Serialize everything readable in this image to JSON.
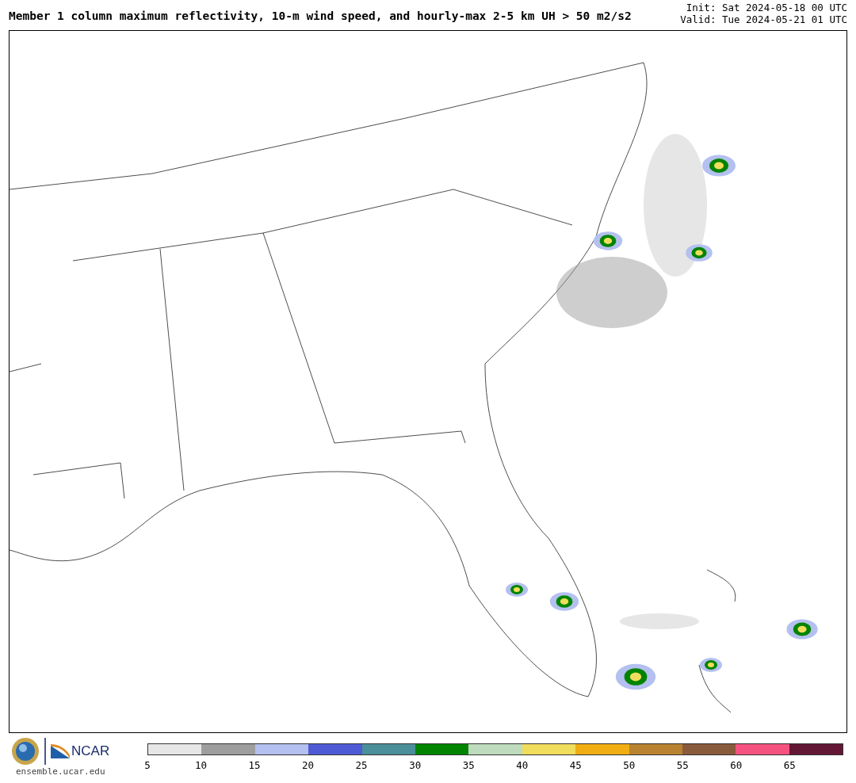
{
  "header": {
    "title": "Member 1 column maximum reflectivity, 10-m wind speed, and hourly-max 2-5 km UH > 50 m2/s2",
    "init": "Init: Sat 2024-05-18 00 UTC",
    "valid": "Valid: Tue 2024-05-21 01 UTC"
  },
  "footer": {
    "logo_text": "NCAR",
    "url": "ensemble.ucar.edu"
  },
  "colorbar": {
    "segments": [
      {
        "color": "#e6e6e6",
        "label": "5"
      },
      {
        "color": "#9e9e9e",
        "label": "10"
      },
      {
        "color": "#b4c0ef",
        "label": "15"
      },
      {
        "color": "#4f5bd5",
        "label": "20"
      },
      {
        "color": "#4a8f99",
        "label": "25"
      },
      {
        "color": "#028400",
        "label": "30"
      },
      {
        "color": "#bedcbd",
        "label": "35"
      },
      {
        "color": "#f1dd5c",
        "label": "40"
      },
      {
        "color": "#f0ae12",
        "label": "45"
      },
      {
        "color": "#b98231",
        "label": "50"
      },
      {
        "color": "#8a5a3c",
        "label": "55"
      },
      {
        "color": "#f5527f",
        "label": "60"
      },
      {
        "color": "#641735",
        "label": "65"
      }
    ]
  }
}
